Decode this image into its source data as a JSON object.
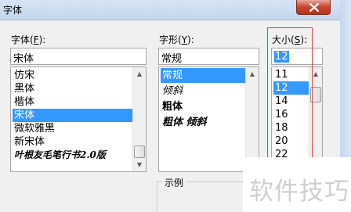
{
  "window": {
    "title": "字体"
  },
  "font_name": {
    "label_text": "字体(",
    "label_key": "F",
    "label_end": "):",
    "value": "宋体",
    "items": [
      {
        "text": "仿宋",
        "selected": false
      },
      {
        "text": "黑体",
        "selected": false
      },
      {
        "text": "楷体",
        "selected": false
      },
      {
        "text": "宋体",
        "selected": true
      },
      {
        "text": "微软雅黑",
        "selected": false
      },
      {
        "text": "新宋体",
        "selected": false
      },
      {
        "text": "叶根友毛笔行书2.0版",
        "selected": false
      }
    ]
  },
  "font_style": {
    "label_text": "字形(",
    "label_key": "Y",
    "label_end": "):",
    "value": "常规",
    "items": [
      {
        "text": "常规",
        "selected": true
      },
      {
        "text": "倾斜",
        "selected": false
      },
      {
        "text": "粗体",
        "selected": false
      },
      {
        "text": "粗体 倾斜",
        "selected": false
      }
    ]
  },
  "font_size": {
    "label_text": "大小(",
    "label_key": "S",
    "label_end": "):",
    "value": "12",
    "items": [
      {
        "text": "11",
        "selected": false
      },
      {
        "text": "12",
        "selected": true
      },
      {
        "text": "14",
        "selected": false
      },
      {
        "text": "16",
        "selected": false
      },
      {
        "text": "18",
        "selected": false
      },
      {
        "text": "20",
        "selected": false
      },
      {
        "text": "22",
        "selected": false
      }
    ]
  },
  "preview": {
    "label": "示例"
  },
  "watermark": "软件技巧",
  "colors": {
    "selection": "#3399ff",
    "highlight_box": "#e04040"
  }
}
